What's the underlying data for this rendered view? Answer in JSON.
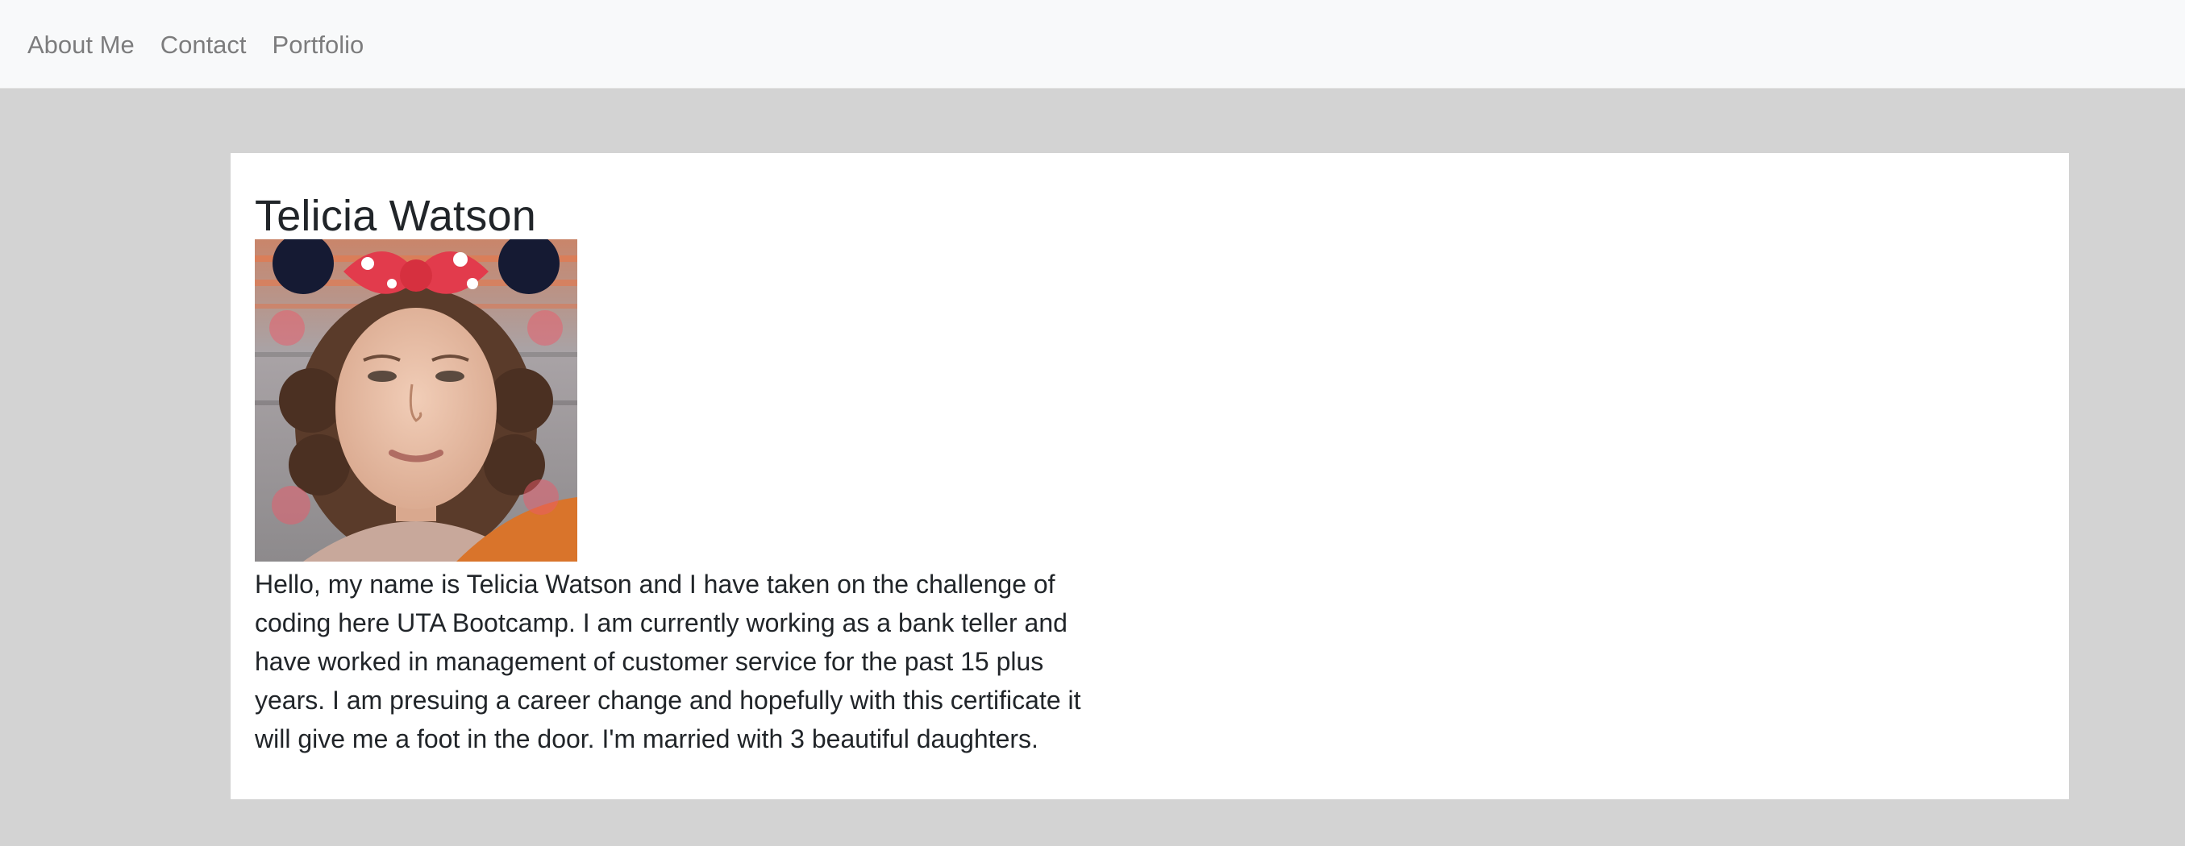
{
  "nav": {
    "links": [
      "About Me",
      "Contact",
      "Portfolio"
    ]
  },
  "profile": {
    "name": "Telicia Watson",
    "photo_alt": "Telicia Watson photo",
    "bio": "Hello, my name is Telicia Watson and I have taken on the challenge of coding here UTA Bootcamp. I am currently working as a bank teller and have worked in management of customer service for the past 15 plus years. I am presuing a career change and hopefully with this certificate it will give me a foot in the door. I'm married with 3 beautiful daughters."
  },
  "colors": {
    "page_bg": "#d3d3d3",
    "navbar_bg": "#f8f9fa",
    "card_bg": "#ffffff",
    "text": "#212529",
    "nav_text": "#808080"
  }
}
